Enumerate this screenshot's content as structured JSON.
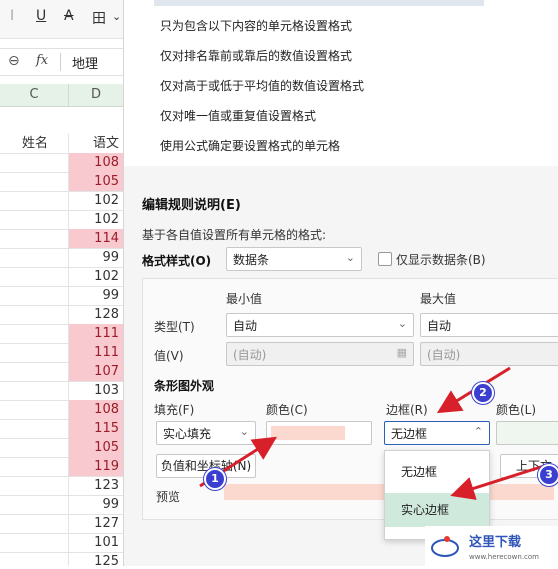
{
  "toolbar": {
    "underline": "U",
    "strike": "A",
    "border": "田",
    "chevron": "⌄"
  },
  "formula_bar": {
    "zoom_icon": "⊖",
    "fx": "fx",
    "value": "地理"
  },
  "columns": {
    "c": "C",
    "d": "D"
  },
  "header_row": {
    "c": "姓名",
    "d": "语文"
  },
  "rows": [
    {
      "v": "108",
      "h": true
    },
    {
      "v": "105",
      "h": true
    },
    {
      "v": "102",
      "h": false
    },
    {
      "v": "102",
      "h": false
    },
    {
      "v": "114",
      "h": true
    },
    {
      "v": "99",
      "h": false
    },
    {
      "v": "102",
      "h": false
    },
    {
      "v": "99",
      "h": false
    },
    {
      "v": "128",
      "h": false
    },
    {
      "v": "111",
      "h": true
    },
    {
      "v": "111",
      "h": true
    },
    {
      "v": "107",
      "h": true
    },
    {
      "v": "103",
      "h": false
    },
    {
      "v": "108",
      "h": true
    },
    {
      "v": "115",
      "h": true
    },
    {
      "v": "105",
      "h": true
    },
    {
      "v": "119",
      "h": true
    },
    {
      "v": "123",
      "h": false
    },
    {
      "v": "99",
      "h": false
    },
    {
      "v": "127",
      "h": false
    },
    {
      "v": "101",
      "h": false
    },
    {
      "v": "125",
      "h": false
    }
  ],
  "rule_types": [
    "只为包含以下内容的单元格设置格式",
    "仅对排名靠前或靠后的数值设置格式",
    "仅对高于或低于平均值的数值设置格式",
    "仅对唯一值或重复值设置格式",
    "使用公式确定要设置格式的单元格"
  ],
  "edit": {
    "title": "编辑规则说明(E)",
    "subtitle": "基于各自值设置所有单元格的格式:",
    "format_style_label": "格式样式(O)",
    "format_style_value": "数据条",
    "show_bar_only": "仅显示数据条(B)",
    "min_label": "最小值",
    "max_label": "最大值",
    "type_label": "类型(T)",
    "type_min": "自动",
    "type_max": "自动",
    "value_label": "值(V)",
    "value_min": "(自动)",
    "value_max": "(自动)",
    "bar_appearance": "条形图外观",
    "fill_label": "填充(F)",
    "color_label": "颜色(C)",
    "border_label": "边框(R)",
    "border_color_label": "颜色(L)",
    "fill_value": "实心填充",
    "border_value": "无边框",
    "negative_button": "负值和坐标轴(N)",
    "direction_button": "上下文",
    "preview_label": "预览"
  },
  "border_dropdown": {
    "items": [
      "无边框",
      "实心边框"
    ],
    "selected": 1
  },
  "badges": [
    "1",
    "2",
    "3"
  ],
  "colors": {
    "fill_swatch": "#fbd9cf",
    "preview_bar": "#fbd9cf",
    "highlight_cell": "#f8c9cf",
    "arrow": "#d8202a",
    "badge": "#3b3fd0"
  }
}
